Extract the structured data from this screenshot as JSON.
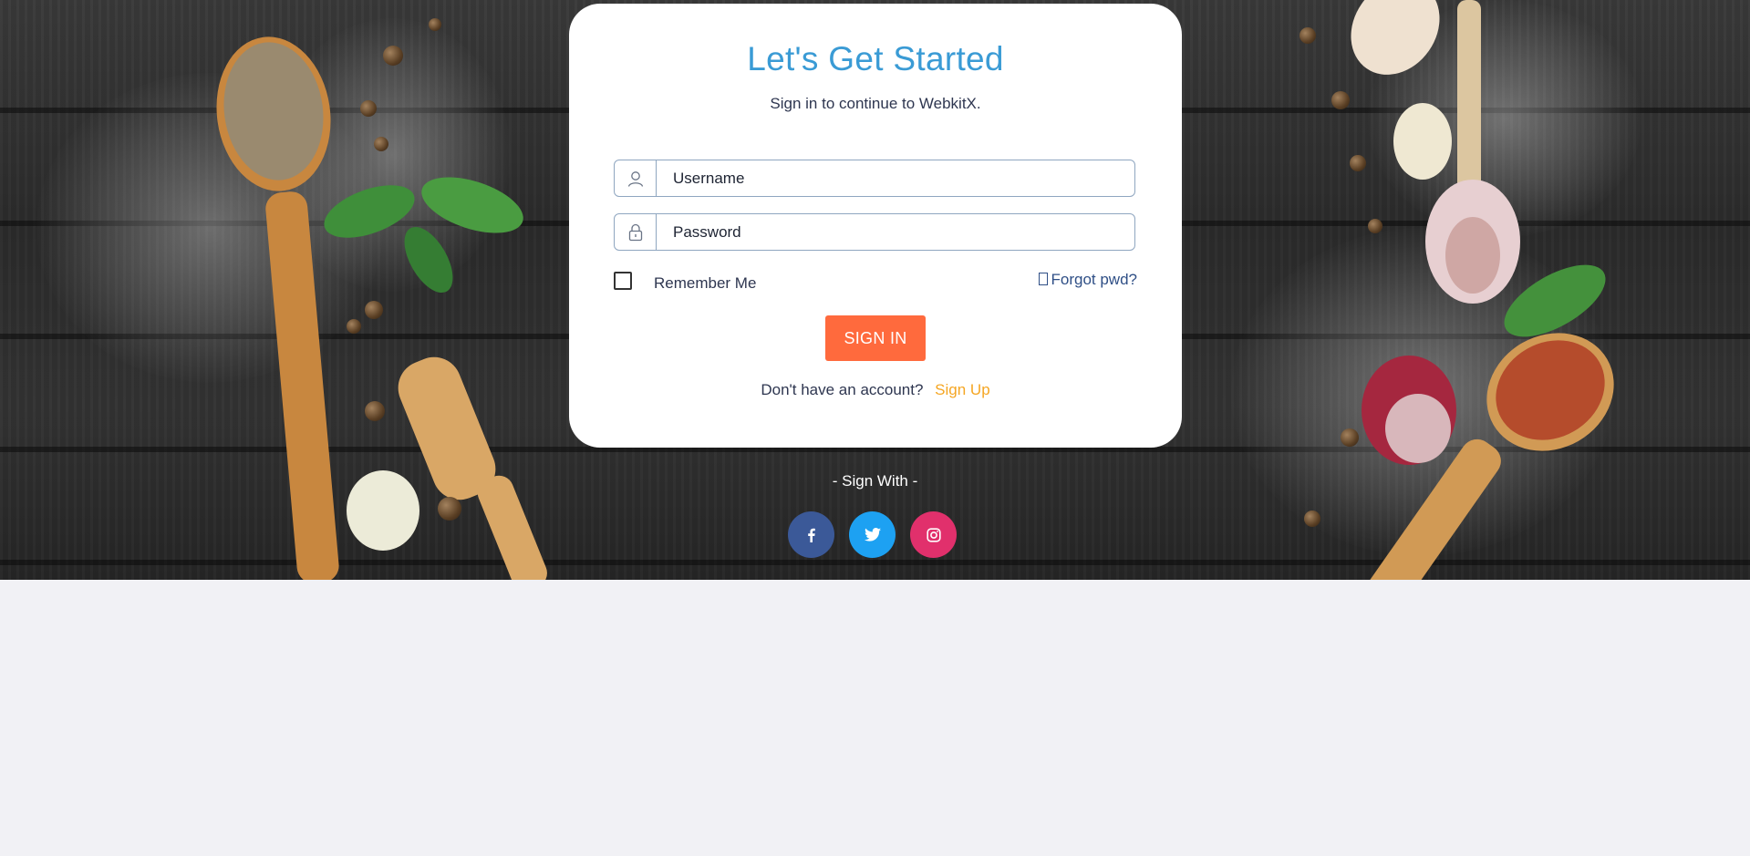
{
  "card": {
    "title": "Let's Get Started",
    "subtitle": "Sign in to continue to WebkitX."
  },
  "form": {
    "username_placeholder": "Username",
    "password_placeholder": "Password",
    "remember_label": "Remember Me",
    "forgot_label": "Forgot pwd?",
    "signin_label": "SIGN IN",
    "no_account_text": "Don't have an account?",
    "signup_label": "Sign Up"
  },
  "social": {
    "heading": "- Sign With -",
    "providers": [
      "facebook",
      "twitter",
      "instagram"
    ]
  },
  "colors": {
    "title": "#3a9bd5",
    "signin_button": "#ff6a3d",
    "signup_link": "#f5a623",
    "facebook": "#3b5998",
    "twitter": "#1da1f2",
    "instagram": "#e1306c",
    "page_background": "#f1f1f5"
  }
}
